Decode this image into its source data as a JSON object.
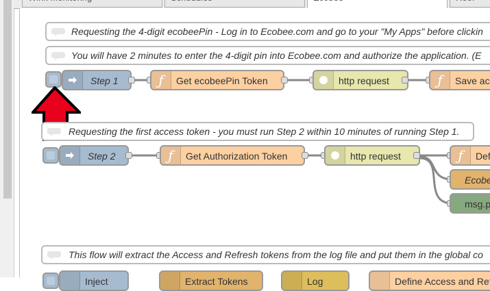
{
  "tabs": [
    {
      "label": "Wink Monitoring",
      "active": false
    },
    {
      "label": "Schedules",
      "active": false
    },
    {
      "label": "Ecobee",
      "active": true
    },
    {
      "label": "Roof",
      "active": false
    }
  ],
  "comments": [
    {
      "text": "Requesting the 4-digit ecobeePin - Log in to Ecobee.com and go to your \"My Apps\" before clickin"
    },
    {
      "text": "You will have 2 minutes to enter the 4-digit pin into Ecobee.com and authorize the application. (E"
    },
    {
      "text": "Requesting the first access token - you must run Step 2 within 10 minutes of running Step 1."
    },
    {
      "text": "This flow will extract the Access and Refresh tokens from the log file and put them in the global co"
    }
  ],
  "flow1": {
    "step_label": "Step 1",
    "function_label": "Get ecobeePin Token",
    "http_label": "http request",
    "save_label": "Save ac"
  },
  "flow2": {
    "step_label": "Step 2",
    "function_label": "Get Authorization Token",
    "http_label": "http request",
    "def_label": "Def",
    "ecobee_label": "Ecobe",
    "debug_label": "msg.p"
  },
  "flow3": {
    "node1_label": "Inject",
    "node2_label": "Extract Tokens",
    "node3_label": "Log",
    "node4_label": "Define Access and Refresh"
  },
  "colors": {
    "inject": "#a6bbcf",
    "function": "#fdd0a2",
    "http": "#e7e7ae",
    "ecobee": "#e2b36d",
    "debug": "#87a980",
    "arrow": "#e8001c"
  }
}
